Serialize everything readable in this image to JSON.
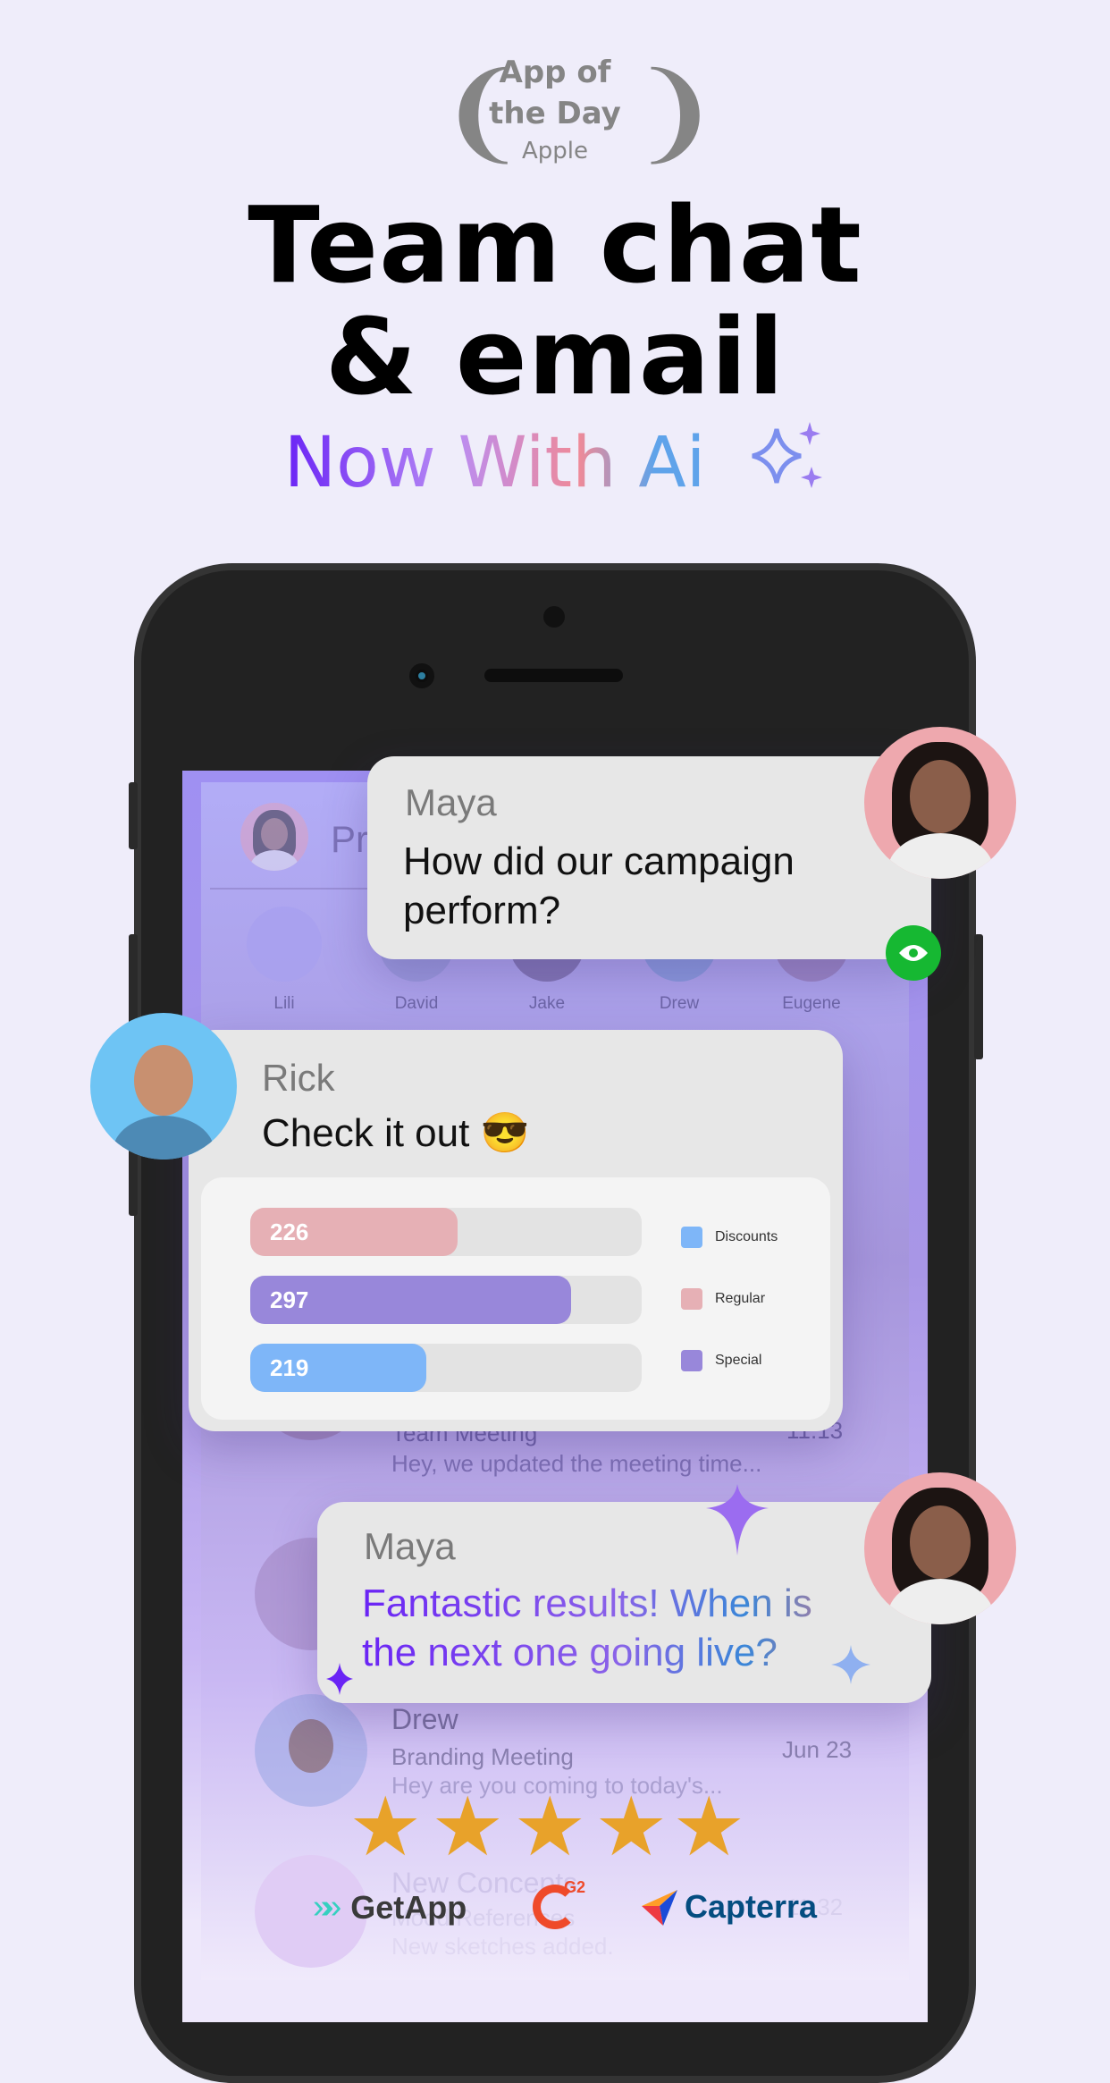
{
  "badge": {
    "line1": "App of",
    "line2": "the Day",
    "line3": "Apple"
  },
  "headline": {
    "line1": "Team chat",
    "line2": "& email",
    "subtitle": "Now With Ai",
    "sparkle_icon": "sparkles-icon"
  },
  "app": {
    "header_partial": "Pr",
    "stories": [
      {
        "name": "Lili"
      },
      {
        "name": "David"
      },
      {
        "name": "Jake"
      },
      {
        "name": "Drew"
      },
      {
        "name": "Eugene"
      }
    ],
    "list": [
      {
        "subject": "Team Meeting",
        "preview": "Hey, we updated the meeting time...",
        "time": "11:13"
      },
      {
        "name": "Drew",
        "subject": "Branding Meeting",
        "preview": "Hey are you coming to today's...",
        "time": "Jun 23"
      },
      {
        "name": "New Concepts",
        "subject": "Mood References",
        "preview": "New sketches added.",
        "time": "11:32"
      }
    ]
  },
  "messages": [
    {
      "sender": "Maya",
      "text": "How did our campaign perform?",
      "seen_icon": "eye-icon",
      "seen_color": "#16b832"
    },
    {
      "sender": "Rick",
      "text": "Check it out 😎"
    },
    {
      "sender": "Maya",
      "text": "Fantastic results! When is the next one going live?"
    }
  ],
  "chart_data": {
    "type": "bar",
    "orientation": "horizontal",
    "bars": [
      {
        "value": 226,
        "fill": 0.53,
        "color": "#e6b0b5"
      },
      {
        "value": 297,
        "fill": 0.82,
        "color": "#9887da"
      },
      {
        "value": 219,
        "fill": 0.45,
        "color": "#7eb6f8"
      }
    ],
    "legend": [
      {
        "label": "Discounts",
        "color": "#7eb6f8"
      },
      {
        "label": "Regular",
        "color": "#e6b0b5"
      },
      {
        "label": "Special",
        "color": "#9887da"
      }
    ],
    "legend_position": "right"
  },
  "rating": {
    "stars": 5,
    "star_color": "#e8a22a"
  },
  "review_logos": {
    "getapp": "GetApp",
    "g2": "G2",
    "capterra": "Capterra"
  }
}
